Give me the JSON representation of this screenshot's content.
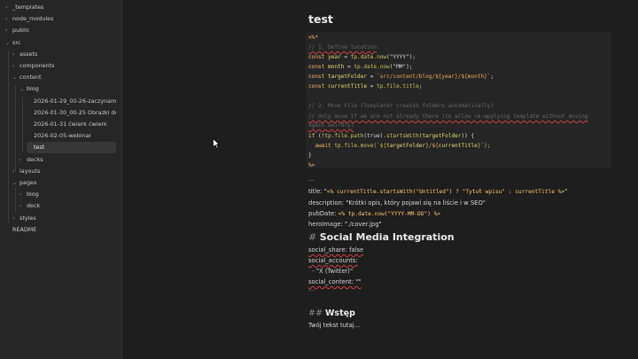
{
  "sidebar": {
    "items": [
      {
        "label": "_templates",
        "chev": "›",
        "depth": 0
      },
      {
        "label": "node_modules",
        "chev": "›",
        "depth": 0
      },
      {
        "label": "public",
        "chev": "›",
        "depth": 0
      },
      {
        "label": "src",
        "chev": "⌄",
        "depth": 0
      },
      {
        "label": "assets",
        "chev": "›",
        "depth": 1
      },
      {
        "label": "components",
        "chev": "›",
        "depth": 1
      },
      {
        "label": "content",
        "chev": "⌄",
        "depth": 1
      },
      {
        "label": "blog",
        "chev": "⌄",
        "depth": 2
      },
      {
        "label": "2026-01-29_00-26-zaczynamy",
        "chev": "",
        "depth": 3
      },
      {
        "label": "2026-01-30_00-25 Obrazki do p...",
        "chev": "",
        "depth": 3
      },
      {
        "label": "2026-01-31 ćwierk ćwierk",
        "chev": "",
        "depth": 3
      },
      {
        "label": "2026-02-05-webinar",
        "chev": "",
        "depth": 3
      },
      {
        "label": "test",
        "chev": "",
        "depth": 3
      },
      {
        "label": "decks",
        "chev": "›",
        "depth": 2
      },
      {
        "label": "layouts",
        "chev": "›",
        "depth": 1
      },
      {
        "label": "pages",
        "chev": "⌄",
        "depth": 1
      },
      {
        "label": "blog",
        "chev": "›",
        "depth": 2
      },
      {
        "label": "deck",
        "chev": "›",
        "depth": 2
      },
      {
        "label": "styles",
        "chev": "›",
        "depth": 1
      },
      {
        "label": "README",
        "chev": "",
        "depth": 0
      }
    ]
  },
  "note": {
    "title": "test",
    "code": {
      "open": "<%*",
      "c1": "// 1. Define location",
      "l_year_kw": "const ",
      "l_year_var": "year",
      "l_year_rest": " = ",
      "l_year_call": "tp.date.now",
      "l_year_arg": "(\"YYYY\");",
      "l_month_kw": "const ",
      "l_month_var": "month",
      "l_month_rest": " = ",
      "l_month_call": "tp.date.now",
      "l_month_arg": "(\"MM\");",
      "l_tf_kw": "const ",
      "l_tf_var": "targetFolder",
      "l_tf_rest": " = ",
      "l_tf_str": "`src/content/blog/${year}/${month}`",
      "l_tf_end": ";",
      "l_ct_kw": "const ",
      "l_ct_var": "currentTitle",
      "l_ct_rest": " = ",
      "l_ct_call": "tp.file.title",
      "l_ct_end": ";",
      "c2": "// 2. Move File (Templater creates folders automatically)",
      "c3": "// Only move if we are not already there (to allow re-applying template without moving",
      "c3b": "again weirdly)",
      "if_kw": "if ",
      "if_rest": "(!",
      "if_call": "tp.file.path",
      "if_rest2": "(true).",
      "if_call2": "startsWith",
      "if_rest3": "(",
      "if_var": "targetFolder",
      "if_rest4": ")) {",
      "aw_kw": "  await ",
      "aw_call": "tp.file.move",
      "aw_rest": "(`${",
      "aw_var": "targetFolder",
      "aw_rest2": "}/${",
      "aw_var2": "currentTitle",
      "aw_rest3": "}`);",
      "close_brace": "}",
      "close": "%>"
    },
    "frontmatter": {
      "sep1": "---",
      "title_key": "title: \"",
      "title_tpl": "<% currentTitle.startsWith(\"Untitled\") ? \"Tytuł wpisu\" : currentTitle %>",
      "title_end": "\"",
      "desc_key": "description: ",
      "desc_val": "\"Krótki opis, który pojawi się na liście i w SEO\"",
      "pub_key": "pubDate: ",
      "pub_val": "<% tp.date.now(\"YYYY-MM-DD\") %>",
      "hero": "heroImage: \"./cover.jpg\""
    },
    "h1": "Social Media Integration",
    "h1_hash": "# ",
    "social_share": "social_share: false",
    "social_accounts": "social_accounts:",
    "twitter": "  - \"X (Twitter)\"",
    "social_content": "social_content: \"\"",
    "sep2": "---",
    "h2_hash": "## ",
    "h2": "Wstęp",
    "body": "Twój tekst tutaj..."
  }
}
